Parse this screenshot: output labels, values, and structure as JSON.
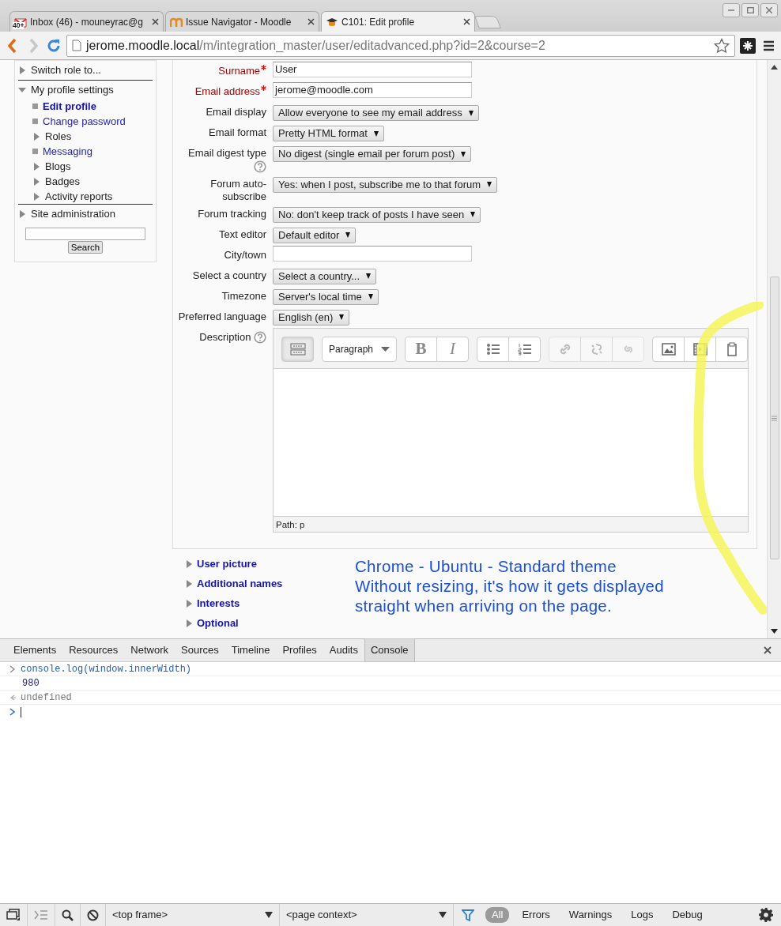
{
  "browser": {
    "tabs": [
      {
        "title": "Inbox (46) - mouneyrac@g",
        "badge": "40+",
        "selected": false
      },
      {
        "title": "Issue Navigator - Moodle",
        "selected": false
      },
      {
        "title": "C101: Edit profile",
        "selected": true
      }
    ],
    "address": {
      "host": "jerome.moodle.local",
      "path": "/m/integration_master/user/editadvanced.php?id=2&course=2"
    }
  },
  "sidebar": {
    "items": [
      {
        "label": "Switch role to...",
        "kind": "branch",
        "expanded": false,
        "link": false,
        "selected": false
      },
      {
        "label": "My profile settings",
        "kind": "branch",
        "expanded": true,
        "link": false,
        "selected": false,
        "children": [
          {
            "label": "Edit profile",
            "kind": "leaf",
            "link": true,
            "selected": true
          },
          {
            "label": "Change password",
            "kind": "leaf",
            "link": true,
            "selected": false
          },
          {
            "label": "Roles",
            "kind": "branch",
            "expanded": false,
            "link": false,
            "selected": false
          },
          {
            "label": "Messaging",
            "kind": "leaf",
            "link": true,
            "selected": false
          },
          {
            "label": "Blogs",
            "kind": "branch",
            "expanded": false,
            "link": false,
            "selected": false
          },
          {
            "label": "Badges",
            "kind": "branch",
            "expanded": false,
            "link": false,
            "selected": false
          },
          {
            "label": "Activity reports",
            "kind": "branch",
            "expanded": false,
            "link": false,
            "selected": false
          }
        ]
      },
      {
        "label": "Site administration",
        "kind": "branch",
        "expanded": false,
        "link": false,
        "selected": false
      }
    ],
    "search_button": "Search"
  },
  "form": {
    "fields": [
      {
        "label": "Surname",
        "required": true,
        "kind": "text",
        "value": "User"
      },
      {
        "label": "Email address",
        "required": true,
        "kind": "text",
        "value": "jerome@moodle.com"
      },
      {
        "label": "Email display",
        "required": false,
        "kind": "select",
        "value": "Allow everyone to see my email address"
      },
      {
        "label": "Email format",
        "required": false,
        "kind": "select",
        "value": "Pretty HTML format"
      },
      {
        "label": "Email digest type",
        "required": false,
        "help": true,
        "kind": "select",
        "value": "No digest (single email per forum post)"
      },
      {
        "label": "Forum auto-subscribe",
        "required": false,
        "kind": "select",
        "value": "Yes: when I post, subscribe me to that forum"
      },
      {
        "label": "Forum tracking",
        "required": false,
        "kind": "select",
        "value": "No: don't keep track of posts I have seen"
      },
      {
        "label": "Text editor",
        "required": false,
        "kind": "select",
        "value": "Default editor"
      },
      {
        "label": "City/town",
        "required": false,
        "kind": "text"
      },
      {
        "label": "Select a country",
        "required": false,
        "kind": "select",
        "value": "Select a country..."
      },
      {
        "label": "Timezone",
        "required": false,
        "kind": "select",
        "value": "Server's local time"
      },
      {
        "label": "Preferred language",
        "required": false,
        "kind": "select",
        "value": "English (en)"
      },
      {
        "label": "Description",
        "required": false,
        "help": true,
        "kind": "editor",
        "editor": {
          "toolbar": [
            [
              {
                "kind": "toggle",
                "disabled": false
              }
            ],
            [
              {
                "kind": "dropdown",
                "text": "Paragraph",
                "disabled": false
              }
            ],
            [
              {
                "kind": "bold",
                "text": "B",
                "disabled": false
              },
              {
                "kind": "italic",
                "text": "I",
                "disabled": false
              }
            ],
            [
              {
                "kind": "bullets",
                "disabled": false
              },
              {
                "kind": "numbers",
                "disabled": false
              }
            ],
            [
              {
                "kind": "link",
                "disabled": true
              },
              {
                "kind": "unlink",
                "disabled": true
              },
              {
                "kind": "nolink",
                "disabled": true
              }
            ],
            [
              {
                "kind": "image",
                "disabled": false
              },
              {
                "kind": "media",
                "disabled": false
              },
              {
                "kind": "paste",
                "disabled": false
              }
            ]
          ],
          "path": "Path: p"
        }
      }
    ],
    "sections": [
      {
        "label": "User picture",
        "expanded": false
      },
      {
        "label": "Additional names",
        "expanded": false
      },
      {
        "label": "Interests",
        "expanded": false
      },
      {
        "label": "Optional",
        "expanded": false
      }
    ]
  },
  "annotation": {
    "lines": [
      "Chrome - Ubuntu - Standard theme",
      "Without resizing, it's how it gets displayed",
      "straight when arriving on the page."
    ]
  },
  "devtools": {
    "tabs": [
      {
        "label": "Elements",
        "selected": false
      },
      {
        "label": "Resources",
        "selected": false
      },
      {
        "label": "Network",
        "selected": false
      },
      {
        "label": "Sources",
        "selected": false
      },
      {
        "label": "Timeline",
        "selected": false
      },
      {
        "label": "Profiles",
        "selected": false
      },
      {
        "label": "Audits",
        "selected": false
      },
      {
        "label": "Console",
        "selected": true
      }
    ],
    "console": [
      {
        "kind": "command",
        "text": "console.log(window.innerWidth)"
      },
      {
        "kind": "log",
        "text": "980"
      },
      {
        "kind": "result",
        "text": "undefined"
      }
    ],
    "toolbar": {
      "frame": "<top frame>",
      "context": "<page context>",
      "filters": [
        {
          "label": "All",
          "selected": true
        },
        {
          "label": "Errors",
          "selected": false
        },
        {
          "label": "Warnings",
          "selected": false
        },
        {
          "label": "Logs",
          "selected": false
        },
        {
          "label": "Debug",
          "selected": false
        }
      ]
    }
  }
}
